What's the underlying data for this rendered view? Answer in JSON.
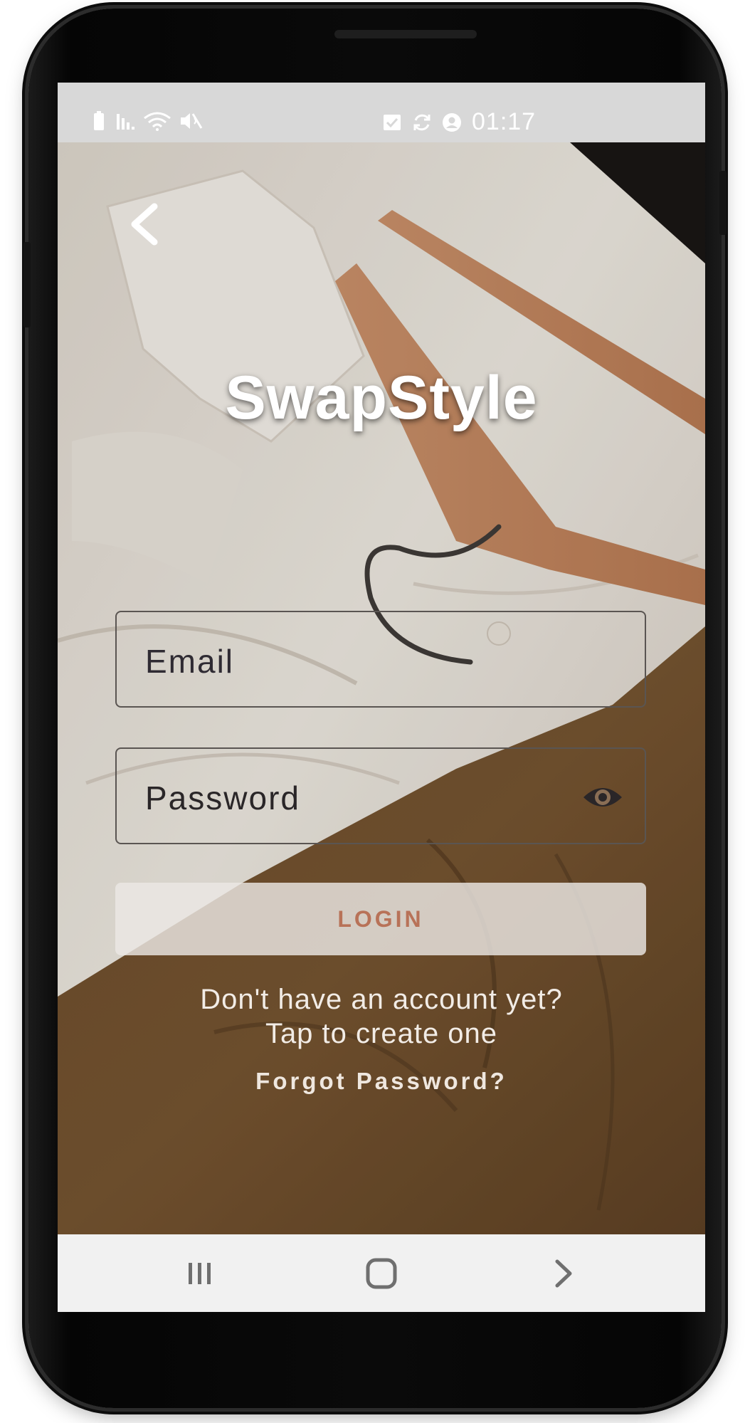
{
  "status_bar": {
    "time": "01:17",
    "left_icons": [
      "battery-icon",
      "signal-icon",
      "wifi-icon",
      "mute-icon"
    ],
    "right_icons": [
      "task-done-icon",
      "sync-icon",
      "account-icon"
    ]
  },
  "app": {
    "title": "SwapStyle"
  },
  "login_form": {
    "email_label": "Email",
    "password_label": "Password",
    "login_label": "LOGIN",
    "signup_line1": "Don't have an account yet?",
    "signup_line2": "Tap to create one",
    "forgot_label": "Forgot Password?"
  },
  "nav_bar": {
    "buttons": [
      "recents-icon",
      "home-icon",
      "back-nav-icon"
    ]
  },
  "colors": {
    "accent": "#b87258",
    "status_bar": "#d8d8d8",
    "nav_bar": "#f1f1f1"
  }
}
